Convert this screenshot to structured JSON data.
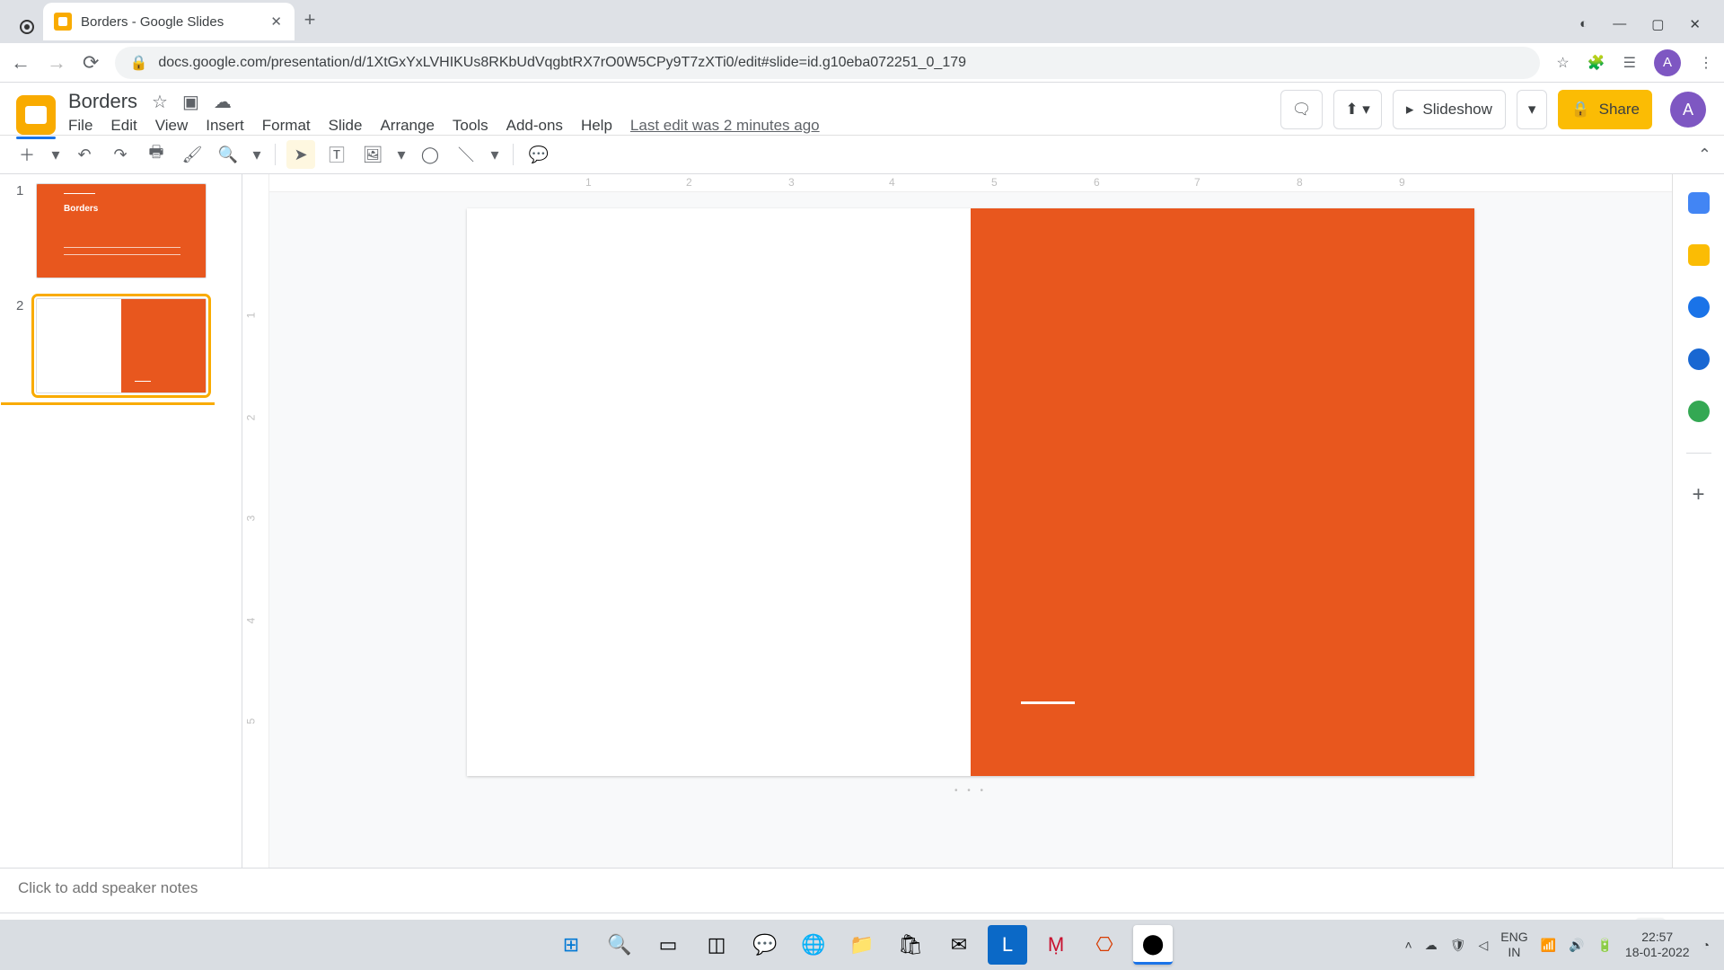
{
  "browser": {
    "tab_title": "Borders - Google Slides",
    "url": "docs.google.com/presentation/d/1XtGxYxLVHIKUs8RKbUdVqgbtRX7rO0W5CPy9T7zXTi0/edit#slide=id.g10eba072251_0_179"
  },
  "doc": {
    "title": "Borders",
    "last_edit": "Last edit was 2 minutes ago",
    "slideshow": "Slideshow",
    "share": "Share"
  },
  "menus": {
    "file": "File",
    "edit": "Edit",
    "view": "View",
    "insert": "Insert",
    "format": "Format",
    "slide": "Slide",
    "arrange": "Arrange",
    "tools": "Tools",
    "addons": "Add-ons",
    "help": "Help"
  },
  "filmstrip": {
    "s1": {
      "num": "1",
      "caption": "Borders"
    },
    "s2": {
      "num": "2"
    }
  },
  "ruler": {
    "h": [
      "1",
      "2",
      "3",
      "4",
      "5",
      "6",
      "7",
      "8",
      "9"
    ],
    "v": [
      "1",
      "2",
      "3",
      "4",
      "5"
    ]
  },
  "notes": {
    "placeholder": "Click to add speaker notes"
  },
  "tray": {
    "lang1": "ENG",
    "lang2": "IN",
    "time": "22:57",
    "date": "18-01-2022"
  },
  "avatar": "A"
}
